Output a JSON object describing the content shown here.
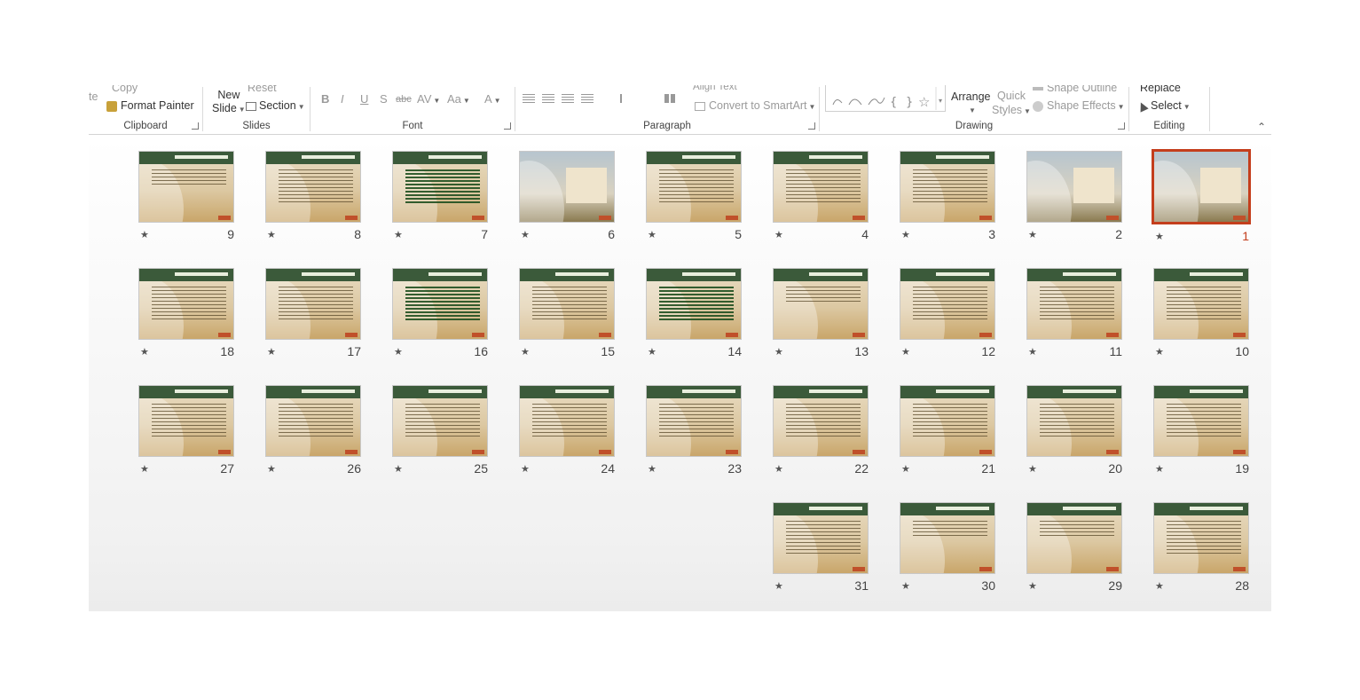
{
  "ribbon": {
    "clipboard": {
      "cut_partial": "te",
      "copy_label": "Copy",
      "format_painter_label": "Format Painter",
      "group_label": "Clipboard"
    },
    "slides": {
      "new_slide_line1": "New",
      "new_slide_line2": "Slide",
      "reset_label": "Reset",
      "section_label": "Section",
      "group_label": "Slides"
    },
    "font": {
      "bold": "B",
      "italic": "I",
      "underline": "U",
      "shadow": "S",
      "strike": "abc",
      "spacing": "AV",
      "case": "Aa",
      "color": "A",
      "group_label": "Font"
    },
    "paragraph": {
      "align_text_label": "Align Text",
      "convert_label": "Convert to SmartArt",
      "group_label": "Paragraph"
    },
    "drawing": {
      "arrange_label": "Arrange",
      "quick_line1": "Quick",
      "quick_line2": "Styles",
      "shape_outline_label": "Shape Outline",
      "shape_effects_label": "Shape Effects",
      "group_label": "Drawing"
    },
    "editing": {
      "replace_label": "Replace",
      "select_label": "Select",
      "group_label": "Editing"
    }
  },
  "slides": [
    {
      "number": "1",
      "kind": "photo",
      "selected": true
    },
    {
      "number": "2",
      "kind": "photo"
    },
    {
      "number": "3",
      "kind": "text"
    },
    {
      "number": "4",
      "kind": "text"
    },
    {
      "number": "5",
      "kind": "text"
    },
    {
      "number": "6",
      "kind": "photo"
    },
    {
      "number": "7",
      "kind": "green"
    },
    {
      "number": "8",
      "kind": "text"
    },
    {
      "number": "9",
      "kind": "short"
    },
    {
      "number": "10",
      "kind": "text"
    },
    {
      "number": "11",
      "kind": "text"
    },
    {
      "number": "12",
      "kind": "text"
    },
    {
      "number": "13",
      "kind": "short"
    },
    {
      "number": "14",
      "kind": "green"
    },
    {
      "number": "15",
      "kind": "text"
    },
    {
      "number": "16",
      "kind": "green"
    },
    {
      "number": "17",
      "kind": "text"
    },
    {
      "number": "18",
      "kind": "text"
    },
    {
      "number": "19",
      "kind": "text"
    },
    {
      "number": "20",
      "kind": "text"
    },
    {
      "number": "21",
      "kind": "text"
    },
    {
      "number": "22",
      "kind": "text"
    },
    {
      "number": "23",
      "kind": "text"
    },
    {
      "number": "24",
      "kind": "text"
    },
    {
      "number": "25",
      "kind": "text"
    },
    {
      "number": "26",
      "kind": "text"
    },
    {
      "number": "27",
      "kind": "text"
    },
    {
      "number": "28",
      "kind": "text"
    },
    {
      "number": "29",
      "kind": "short"
    },
    {
      "number": "30",
      "kind": "short"
    },
    {
      "number": "31",
      "kind": "text"
    }
  ],
  "icons": {
    "star": "★",
    "collapse": "⌃"
  },
  "colors": {
    "selection": "#c43e1c",
    "header_green": "#3b5a3a"
  }
}
